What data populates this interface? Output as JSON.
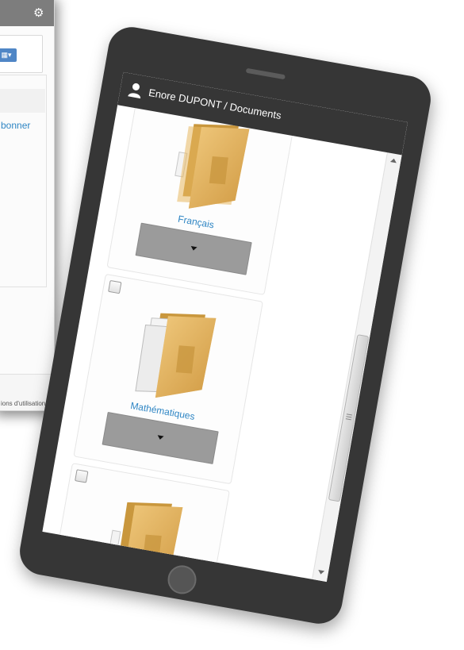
{
  "background_window": {
    "link_text": "bonner",
    "footer_text": "ions d'utilisation"
  },
  "tablet": {
    "header": {
      "title": "Enore DUPONT / Documents"
    },
    "folders": [
      {
        "label": "Français",
        "icon": "folder-icon"
      },
      {
        "label": "Mathématiques",
        "icon": "folder-with-documents-icon"
      },
      {
        "label": "",
        "icon": "folder-icon"
      }
    ]
  },
  "colors": {
    "tablet_frame": "#363636",
    "link_blue": "#2f86c4",
    "menu_gray": "#9b9b9b",
    "folder_gold": "#d8a84c"
  }
}
